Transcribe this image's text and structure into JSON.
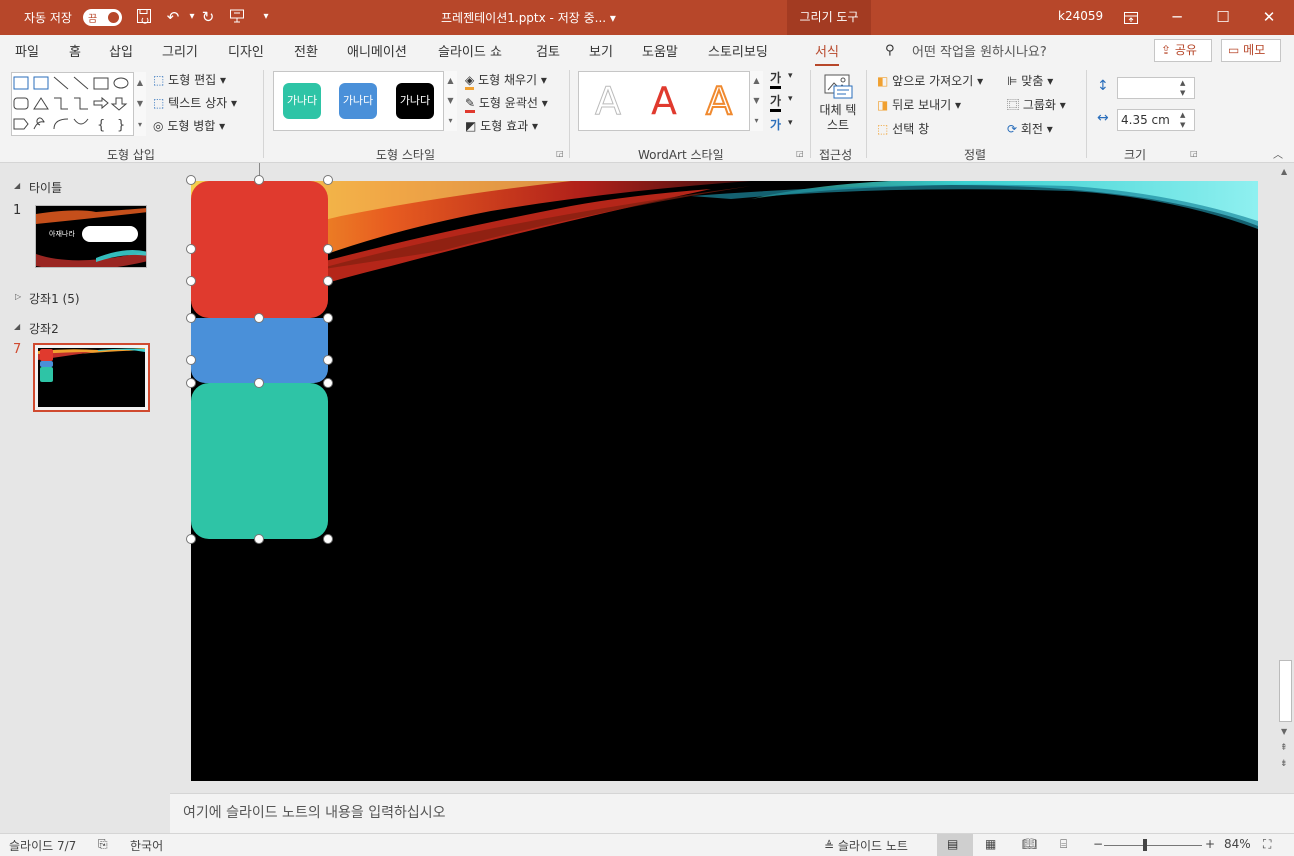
{
  "titlebar": {
    "autosave_label": "자동 저장",
    "autosave_state": "끔",
    "doc_title": "프레젠테이션1.pptx  -  저장 중...  ▾",
    "context_tab": "그리기 도구",
    "user": "k24059"
  },
  "tabs": [
    "파일",
    "홈",
    "삽입",
    "그리기",
    "디자인",
    "전환",
    "애니메이션",
    "슬라이드 쇼",
    "검토",
    "보기",
    "도움말",
    "스토리보딩",
    "서식"
  ],
  "active_tab": "서식",
  "tell_me": "어떤 작업을 원하시나요?",
  "share_label": "공유",
  "comments_label": "메모",
  "ribbon": {
    "insert_shapes": {
      "label": "도형 삽입",
      "edit_shape": "도형 편집",
      "text_box": "텍스트 상자",
      "merge_shapes": "도형 병합"
    },
    "shape_styles": {
      "label": "도형 스타일",
      "swatch_text": "가나다",
      "swatch_colors": [
        "#2ec4a6",
        "#4a90d9",
        "#000000"
      ],
      "fill": "도형 채우기",
      "outline": "도형 윤곽선",
      "effects": "도형 효과"
    },
    "wordart": {
      "label": "WordArt 스타일",
      "letter": "A",
      "text_fill": "가",
      "text_outline": "가",
      "text_effects": "가"
    },
    "accessibility": {
      "label": "접근성",
      "alt_text": "대체 텍스트"
    },
    "arrange": {
      "label": "정렬",
      "bring_forward": "앞으로 가져오기",
      "send_backward": "뒤로 보내기",
      "selection_pane": "선택 창",
      "align": "맞춤",
      "group": "그룹화",
      "rotate": "회전"
    },
    "size": {
      "label": "크기",
      "height": "",
      "width": "4.35 cm"
    }
  },
  "slide_panel": {
    "sections": [
      {
        "name": "타이틀",
        "expanded": true
      },
      {
        "name": "강좌1 (5)",
        "expanded": false
      },
      {
        "name": "강좌2",
        "expanded": true
      }
    ],
    "slides": [
      {
        "number": "1",
        "thumb_text": "아재나라"
      },
      {
        "number": "7",
        "selected": true
      }
    ]
  },
  "slide": {
    "shapes": [
      {
        "name": "red-rounded-rect",
        "color": "#e03a2e"
      },
      {
        "name": "blue-rounded-rect",
        "color": "#4a90d9"
      },
      {
        "name": "teal-rounded-rect",
        "color": "#2ec4a6"
      }
    ]
  },
  "notes_placeholder": "여기에 슬라이드 노트의 내용을 입력하십시오",
  "status": {
    "slide_count": "슬라이드 7/7",
    "language": "한국어",
    "notes_button": "슬라이드 노트",
    "zoom": "84%"
  },
  "colors": {
    "accent": "#b7472a",
    "selected_thumb_border": "#d04a2f"
  }
}
